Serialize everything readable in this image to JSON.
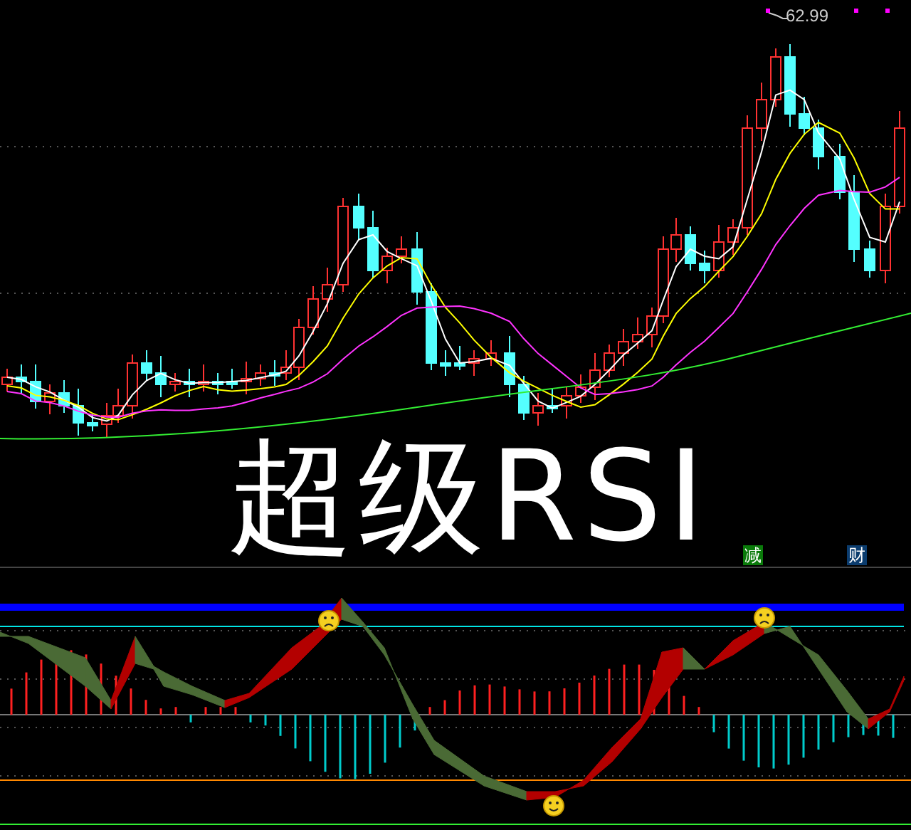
{
  "chart": {
    "title": "超级RSI",
    "max_label": "62.99"
  },
  "badges": [
    {
      "text": "减",
      "color": "#0a7a0a"
    },
    {
      "text": "财",
      "color": "#0b3c6e"
    }
  ]
}
